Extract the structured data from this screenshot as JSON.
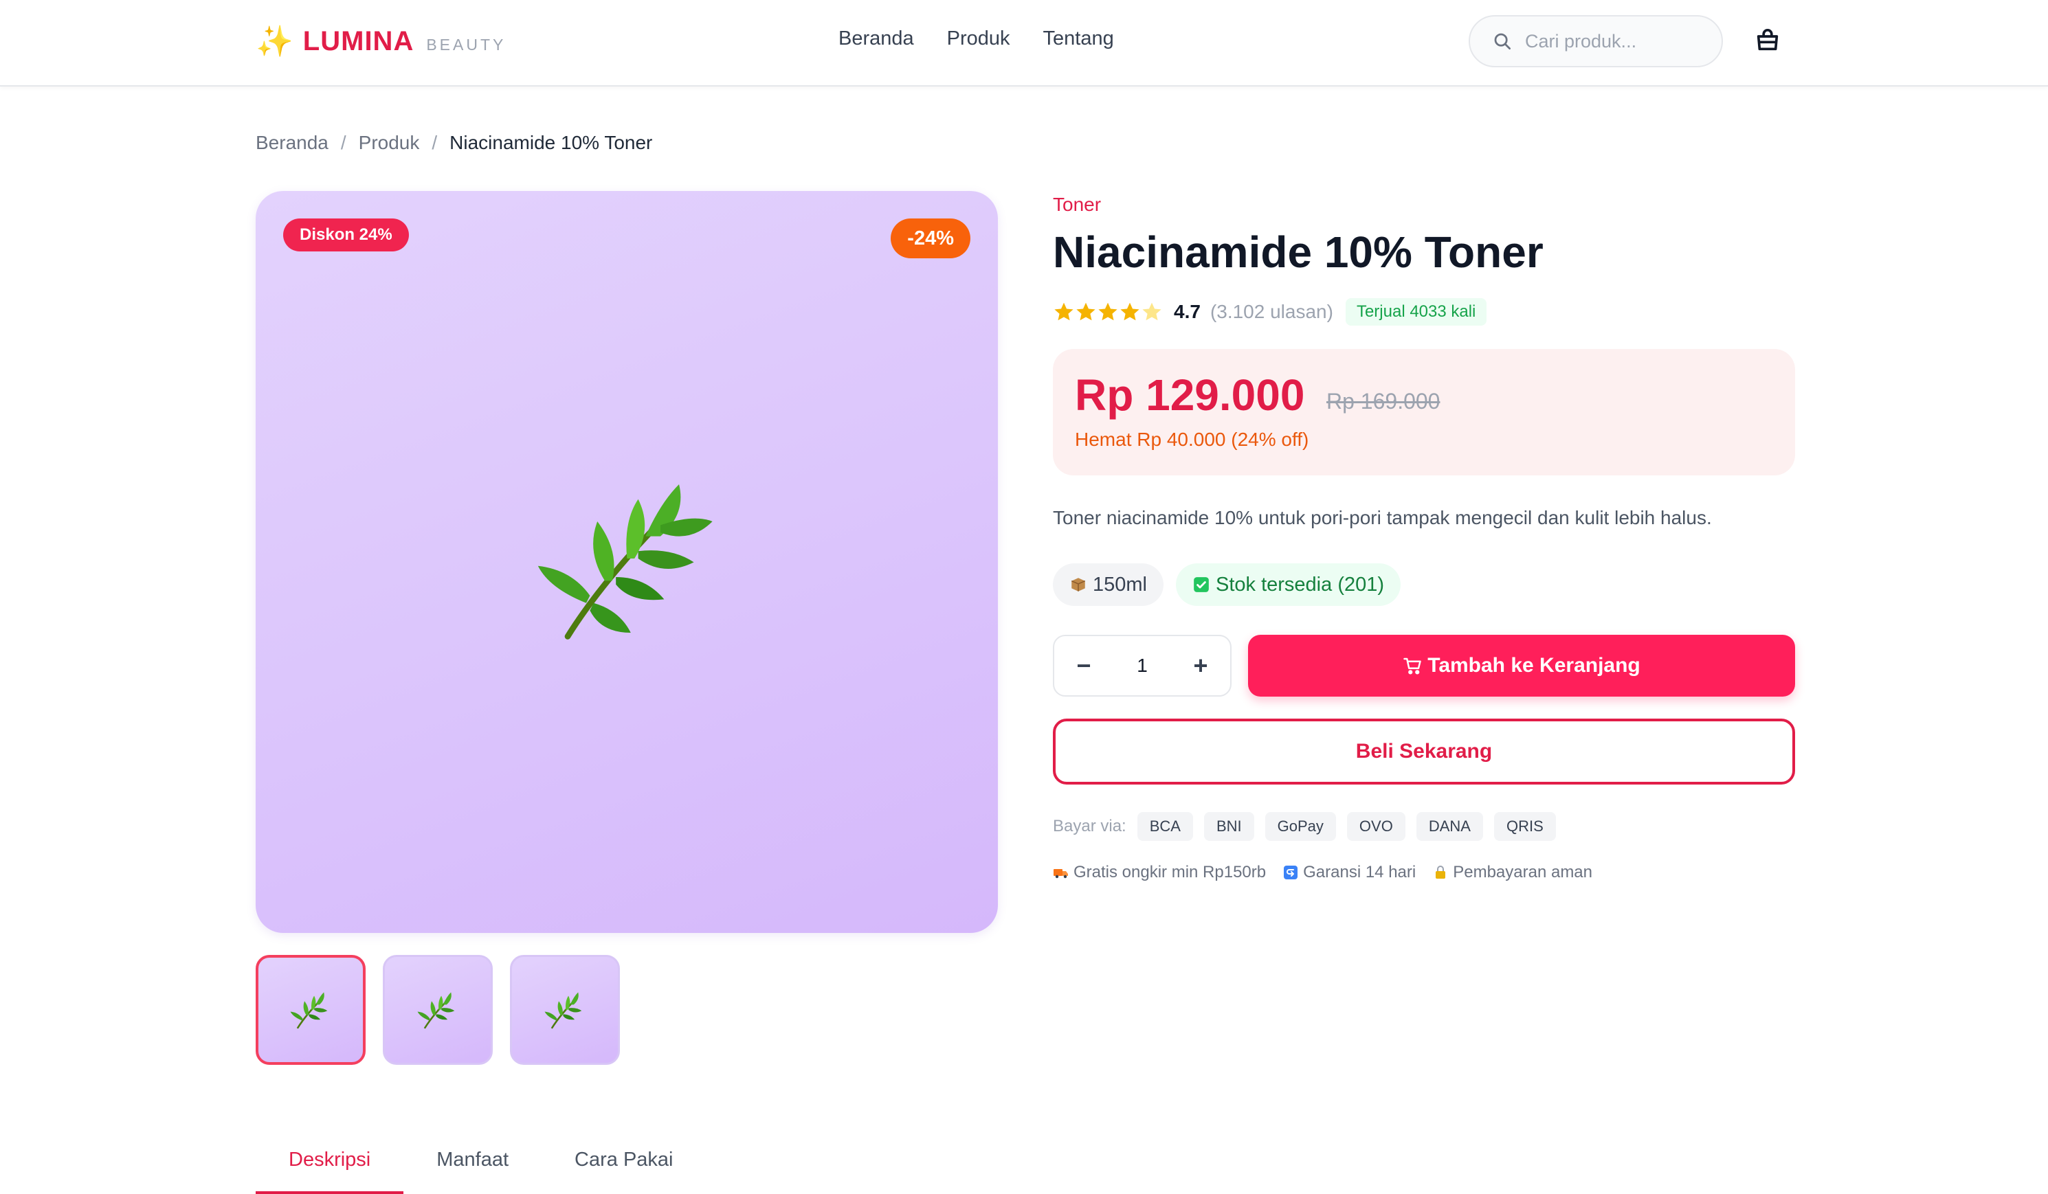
{
  "header": {
    "brand": "LUMINA",
    "brand_sub": "BEAUTY",
    "nav": [
      "Beranda",
      "Produk",
      "Tentang"
    ],
    "search_placeholder": "Cari produk..."
  },
  "breadcrumb": {
    "items": [
      "Beranda",
      "Produk"
    ],
    "current": "Niacinamide 10% Toner"
  },
  "gallery": {
    "badge_discount": "Diskon 24%",
    "badge_percent": "-24%",
    "thumbnail_count": 3,
    "active_thumbnail": 1
  },
  "product": {
    "category": "Toner",
    "title": "Niacinamide 10% Toner",
    "rating": "4.7",
    "rating_fraction": 0.94,
    "reviews": "(3.102 ulasan)",
    "sold": "Terjual 4033 kali",
    "price": "Rp 129.000",
    "price_old": "Rp 169.000",
    "saving": "Hemat Rp 40.000 (24% off)",
    "description": "Toner niacinamide 10% untuk pori-pori tampak mengecil dan kulit lebih halus.",
    "size": "150ml",
    "stock": "Stok tersedia (201)",
    "quantity": "1"
  },
  "actions": {
    "add_to_cart": "Tambah ke Keranjang",
    "buy_now": "Beli Sekarang",
    "qty_minus": "−",
    "qty_plus": "+"
  },
  "payment": {
    "label": "Bayar via:",
    "methods": [
      "BCA",
      "BNI",
      "GoPay",
      "OVO",
      "DANA",
      "QRIS"
    ]
  },
  "perks": [
    "Gratis ongkir min Rp150rb",
    "Garansi 14 hari",
    "Pembayaran aman"
  ],
  "tabs": [
    "Deskripsi",
    "Manfaat",
    "Cara Pakai"
  ],
  "colors": {
    "accent": "#e11d48",
    "cta": "#ff1f5a",
    "badge_orange": "#f8620b",
    "image_bg": "#dcc6fc"
  }
}
